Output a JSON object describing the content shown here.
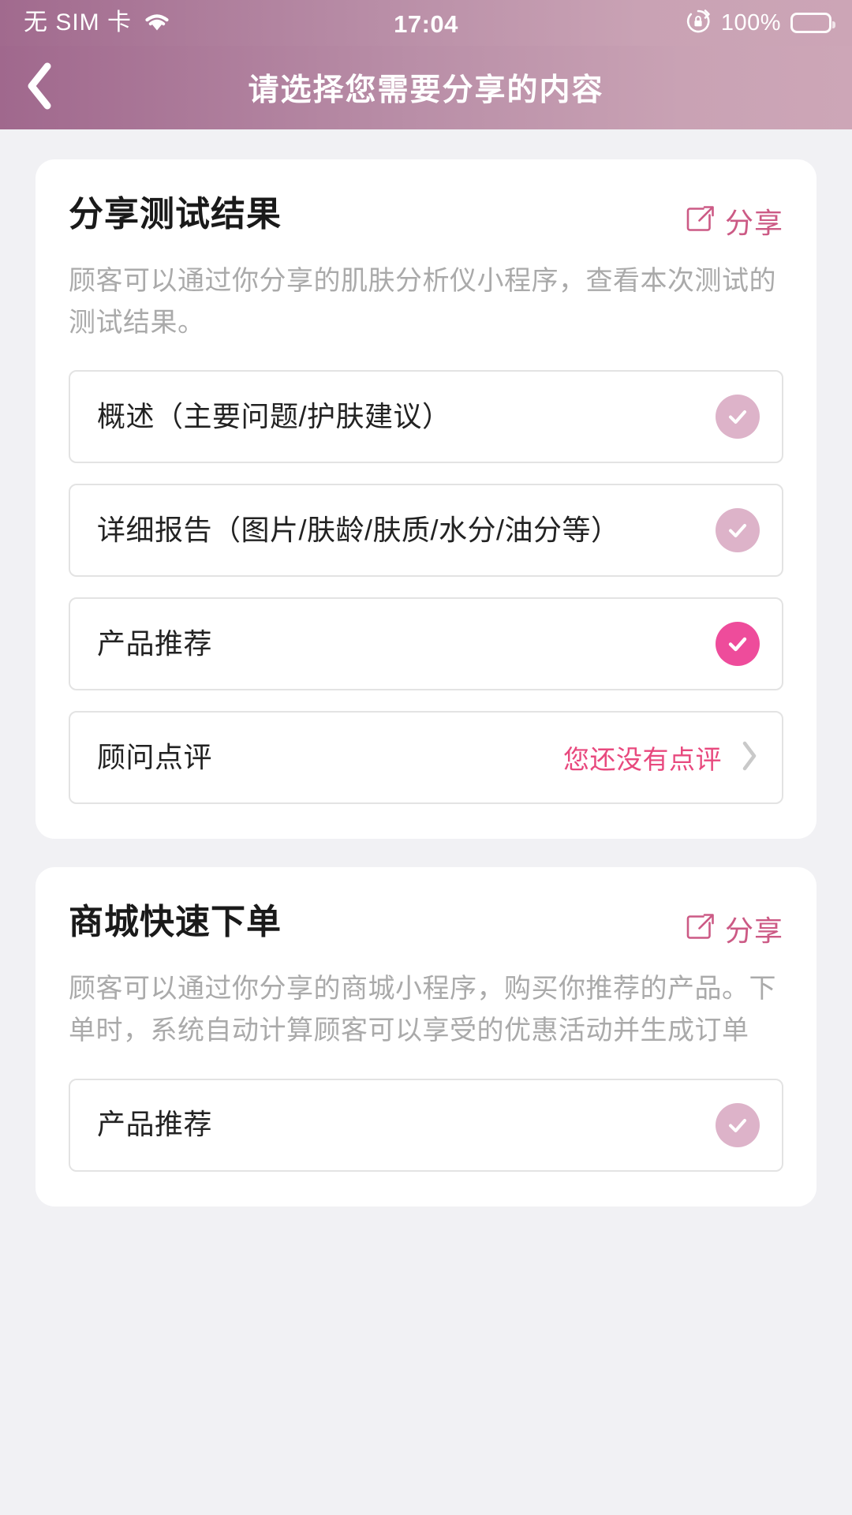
{
  "status_bar": {
    "carrier": "无 SIM 卡",
    "wifi_icon": "wifi-icon",
    "time": "17:04",
    "rotation_lock_icon": "rotation-lock-icon",
    "battery_percent": "100%",
    "battery_icon": "battery-full-icon"
  },
  "nav": {
    "back_icon": "chevron-left-icon",
    "title": "请选择您需要分享的内容"
  },
  "theme": {
    "accent_pink": "#ee4c9b",
    "muted_pink": "#ddb3c9",
    "share_pink": "#cc5a85",
    "value_pink": "#e8497e",
    "header_gradient_start": "#a0688d",
    "header_gradient_end": "#cda6b7",
    "page_background": "#f1f1f4"
  },
  "cards": [
    {
      "title": "分享测试结果",
      "share": {
        "icon": "share-external-icon",
        "label": "分享"
      },
      "description": "顾客可以通过你分享的肌肤分析仪小程序，查看本次测试的测试结果。",
      "rows": [
        {
          "label": "概述（主要问题/护肤建议）",
          "control": "check",
          "state": "muted"
        },
        {
          "label": "详细报告（图片/肤龄/肤质/水分/油分等）",
          "control": "check",
          "state": "muted"
        },
        {
          "label": "产品推荐",
          "control": "check",
          "state": "active"
        },
        {
          "label": "顾问点评",
          "control": "link",
          "value": "您还没有点评",
          "chevron_icon": "chevron-right-icon"
        }
      ]
    },
    {
      "title": "商城快速下单",
      "share": {
        "icon": "share-external-icon",
        "label": "分享"
      },
      "description": "顾客可以通过你分享的商城小程序，购买你推荐的产品。下单时，系统自动计算顾客可以享受的优惠活动并生成订单",
      "rows": [
        {
          "label": "产品推荐",
          "control": "check",
          "state": "muted"
        }
      ]
    }
  ]
}
